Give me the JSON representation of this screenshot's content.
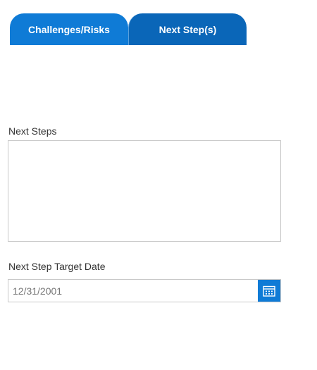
{
  "tabs": [
    {
      "label": "Challenges/Risks"
    },
    {
      "label": "Next Step(s)"
    }
  ],
  "next_steps": {
    "label": "Next Steps",
    "value": ""
  },
  "target_date": {
    "label": "Next Step Target Date",
    "placeholder": "12/31/2001",
    "value": ""
  },
  "icons": {
    "calendar": "calendar-icon"
  },
  "colors": {
    "tab_active": "#0f7bd6",
    "tab_selected": "#0a66b8",
    "calendar_button": "#0f7bd6",
    "border": "#c8c8c8"
  }
}
